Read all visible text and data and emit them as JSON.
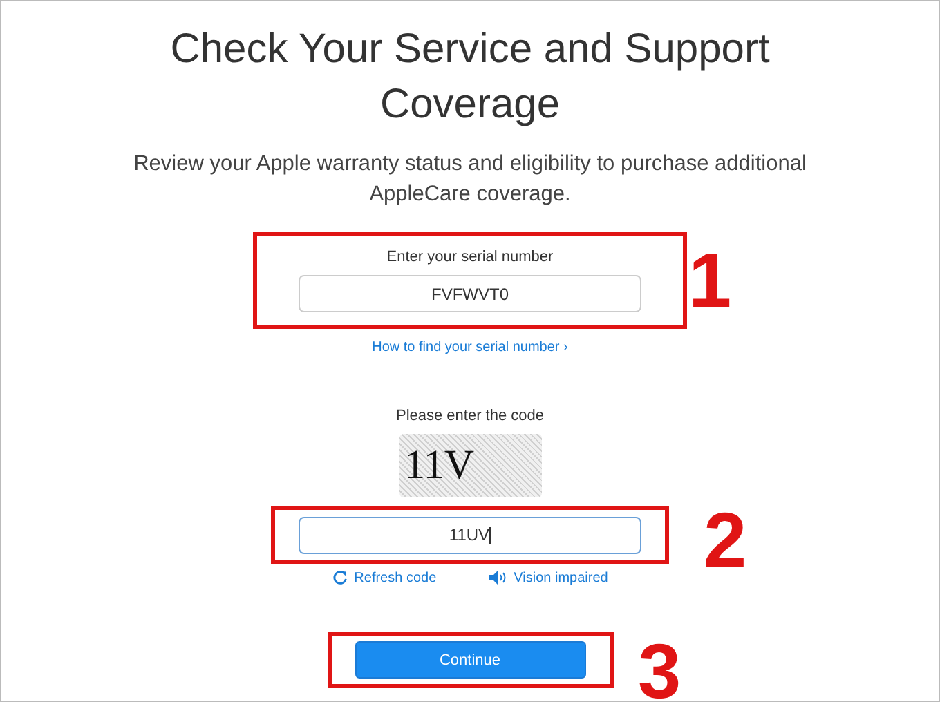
{
  "title": "Check Your Service and Support Coverage",
  "subtitle": "Review your Apple warranty status and eligibility to purchase additional AppleCare coverage.",
  "serial": {
    "label": "Enter your serial number",
    "value": "FVFWVT0",
    "marker": "1"
  },
  "help_link": "How to find your serial number ›",
  "captcha": {
    "label": "Please enter the code",
    "text": "11V"
  },
  "code": {
    "value": "11UV",
    "marker": "2"
  },
  "links": [
    {
      "kind": "refresh",
      "label": "Refresh code"
    },
    {
      "kind": "audio",
      "label": "Vision impaired"
    }
  ],
  "continue": {
    "label": "Continue",
    "marker": "3"
  }
}
